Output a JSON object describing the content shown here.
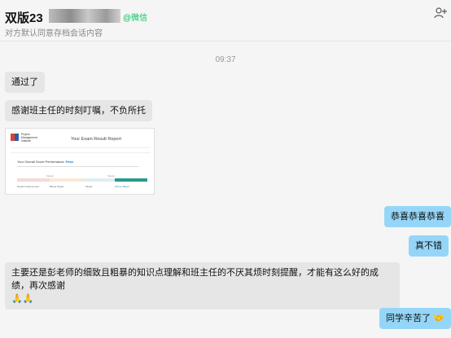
{
  "header": {
    "title_visible": "双版23",
    "wechat_tag": "@微信",
    "subtitle": "对方默认同意存档会话内容"
  },
  "timestamp": "09:37",
  "messages": {
    "m1": "通过了",
    "m2": "感谢班主任的时刻叮嘱，不负所托",
    "m3": "恭喜恭喜恭喜",
    "m4": "真不错",
    "m5_text": "主要还是彭老师的细致且粗暴的知识点理解和班主任的不厌其烦时刻提醒，才能有这么好的成绩，再次感谢",
    "m5_emoji": "🙏🙏",
    "m6_text": "同学辛苦了",
    "m6_emoji": "🤝"
  },
  "report": {
    "org": "Project Management Institute",
    "title": "Your Exam Result Report",
    "overall_label": "Your Overall Score Performance:",
    "overall_value": "Pass",
    "bars": [
      "Needs Improvement",
      "Below Target",
      "Target",
      "Above Target"
    ]
  },
  "colors": {
    "self_bubble": "#95d6f8",
    "other_bubble": "#e6e6e6",
    "wechat": "#07c160",
    "background": "#f5f5f5"
  },
  "icons": {
    "add_member": "user-add-icon"
  }
}
